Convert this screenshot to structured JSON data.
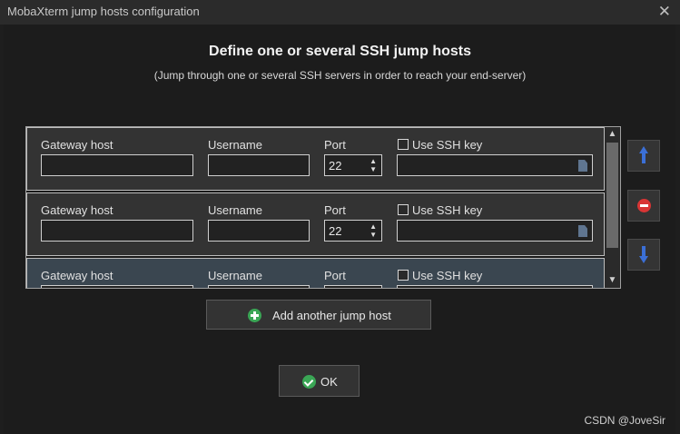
{
  "window": {
    "title": "MobaXterm jump hosts configuration",
    "close_glyph": "✕"
  },
  "heading": "Define one or several SSH jump hosts",
  "subheading": "(Jump through one or several SSH servers in order to reach your end-server)",
  "rows": [
    {
      "gateway_label": "Gateway host",
      "username_label": "Username",
      "port_label": "Port",
      "port_value": "22",
      "ssh_key_label": "Use SSH key",
      "gateway_value": "",
      "username_value": "",
      "ssh_key_value": ""
    },
    {
      "gateway_label": "Gateway host",
      "username_label": "Username",
      "port_label": "Port",
      "port_value": "22",
      "ssh_key_label": "Use SSH key",
      "gateway_value": "",
      "username_value": "",
      "ssh_key_value": ""
    },
    {
      "gateway_label": "Gateway host",
      "username_label": "Username",
      "port_label": "Port",
      "port_value": "",
      "ssh_key_label": "Use SSH key",
      "gateway_value": "",
      "username_value": "",
      "ssh_key_value": ""
    }
  ],
  "buttons": {
    "add_label": "Add another jump host",
    "ok_label": "OK"
  },
  "icons": {
    "move_up": "arrow-up-icon",
    "remove": "minus-circle-icon",
    "move_down": "arrow-down-icon",
    "add": "plus-circle-icon",
    "ok": "check-circle-icon"
  },
  "colors": {
    "accent_blue": "#3b6fd6",
    "remove_red": "#d83535",
    "ok_green": "#3aa655"
  },
  "watermark": "CSDN @JoveSir"
}
